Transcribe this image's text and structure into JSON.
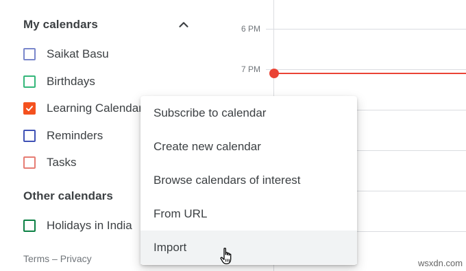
{
  "sidebar": {
    "my_calendars_title": "My calendars",
    "my_calendars": [
      {
        "label": "Saikat Basu",
        "color": "#7986cb",
        "checked": false
      },
      {
        "label": "Birthdays",
        "color": "#33b679",
        "checked": false
      },
      {
        "label": "Learning Calendar",
        "color": "#f4511e",
        "checked": true
      },
      {
        "label": "Reminders",
        "color": "#3f51b5",
        "checked": false
      },
      {
        "label": "Tasks",
        "color": "#e67c73",
        "checked": false
      }
    ],
    "other_calendars_title": "Other calendars",
    "other_calendars": [
      {
        "label": "Holidays in India",
        "color": "#0b8043",
        "checked": false
      }
    ],
    "footer": {
      "terms": "Terms",
      "separator": "–",
      "privacy": "Privacy"
    }
  },
  "grid": {
    "time_labels": [
      "6 PM",
      "7 PM"
    ],
    "now_color": "#ea4335"
  },
  "menu": {
    "items": [
      {
        "label": "Subscribe to calendar"
      },
      {
        "label": "Create new calendar"
      },
      {
        "label": "Browse calendars of interest"
      },
      {
        "label": "From URL"
      },
      {
        "label": "Import",
        "hovered": true
      }
    ]
  },
  "watermark": "wsxdn.com"
}
